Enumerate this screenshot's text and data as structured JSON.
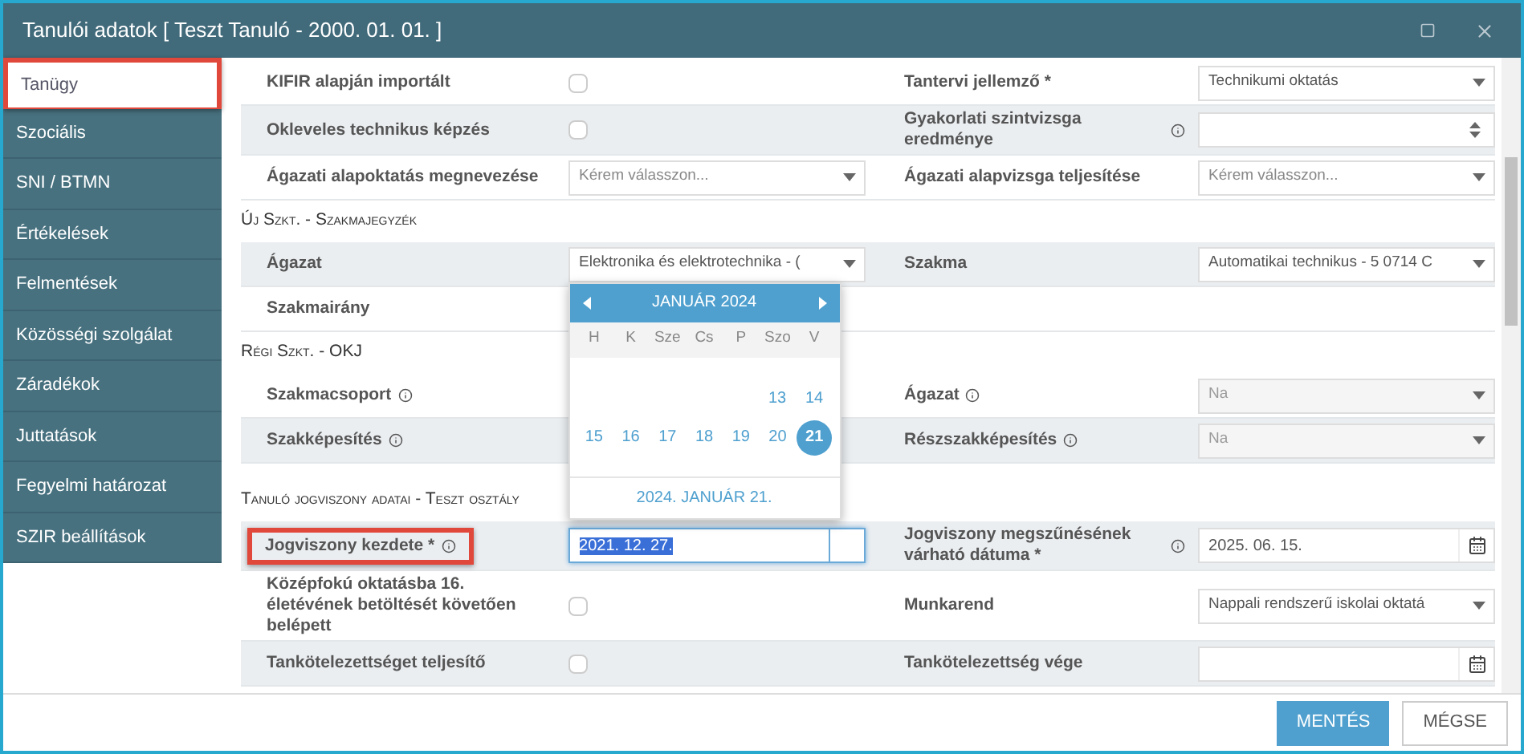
{
  "window": {
    "title": "Tanulói adatok [ Teszt Tanuló - 2000. 01. 01. ]"
  },
  "sidebar": {
    "items": [
      {
        "label": "Tanügy",
        "selected": true,
        "annotated": true
      },
      {
        "label": "Szociális",
        "selected": false,
        "annotated": false
      },
      {
        "label": "SNI / BTMN",
        "selected": false,
        "annotated": false
      },
      {
        "label": "Értékelések",
        "selected": false,
        "annotated": false
      },
      {
        "label": "Felmentések",
        "selected": false,
        "annotated": false
      },
      {
        "label": "Közösségi szolgálat",
        "selected": false,
        "annotated": false
      },
      {
        "label": "Záradékok",
        "selected": false,
        "annotated": false
      },
      {
        "label": "Juttatások",
        "selected": false,
        "annotated": false
      },
      {
        "label": "Fegyelmi határozat",
        "selected": false,
        "annotated": false
      },
      {
        "label": "SZIR beállítások",
        "selected": false,
        "annotated": false
      }
    ]
  },
  "sections": [
    {
      "rows": [
        {
          "striped": false,
          "left": {
            "label": "KIFIR alapján importált",
            "control": {
              "kind": "checkbox",
              "checked": false
            }
          },
          "right": {
            "label": "Tantervi jellemző *",
            "control": {
              "kind": "select",
              "value": "Technikumi oktatás",
              "disabled": false
            }
          }
        },
        {
          "striped": true,
          "left": {
            "label": "Okleveles technikus képzés",
            "control": {
              "kind": "checkbox",
              "checked": false
            }
          },
          "right": {
            "label": "Gyakorlati szintvizsga eredménye",
            "info": true,
            "control": {
              "kind": "number"
            }
          }
        },
        {
          "striped": false,
          "left": {
            "label": "Ágazati alapoktatás megnevezése",
            "control": {
              "kind": "select",
              "placeholder": "Kérem válasszon...",
              "disabled": false
            }
          },
          "right": {
            "label": "Ágazati alapvizsga teljesítése",
            "control": {
              "kind": "select",
              "placeholder": "Kérem válasszon...",
              "disabled": false
            }
          }
        }
      ]
    },
    {
      "title": "Új Szkt. - Szakmajegyzék",
      "rows": [
        {
          "striped": true,
          "left": {
            "label": "Ágazat",
            "control": {
              "kind": "select",
              "value": "Elektronika és elektrotechnika - (",
              "disabled": false,
              "popup": {
                "month": "JANUÁR 2024",
                "weekdays": [
                  "H",
                  "K",
                  "Sze",
                  "Cs",
                  "P",
                  "Szo",
                  "V"
                ],
                "weeks": [
                  {
                    "days": [
                      {
                        "day": "13",
                        "selected": false
                      },
                      {
                        "day": "14",
                        "selected": false
                      }
                    ]
                  },
                  {
                    "days": [
                      {
                        "day": "15",
                        "selected": false
                      },
                      {
                        "day": "16",
                        "selected": false
                      },
                      {
                        "day": "17",
                        "selected": false
                      },
                      {
                        "day": "18",
                        "selected": false
                      },
                      {
                        "day": "19",
                        "selected": false
                      },
                      {
                        "day": "20",
                        "selected": false
                      },
                      {
                        "day": "21",
                        "selected": true
                      }
                    ]
                  }
                ],
                "footer": "2024. JANUÁR 21."
              }
            }
          },
          "right": {
            "label": "Szakma",
            "control": {
              "kind": "select",
              "value": "Automatikai technikus - 5 0714 C",
              "disabled": false
            }
          }
        },
        {
          "striped": false,
          "left": {
            "label": "Szakmairány"
          }
        }
      ]
    },
    {
      "title": "Régi Szkt. - OKJ",
      "rows": [
        {
          "striped": false,
          "left": {
            "label": "Szakmacsoport",
            "info": true
          },
          "right": {
            "label": "Ágazat",
            "info": true,
            "control": {
              "kind": "select",
              "value": "Na",
              "disabled": true
            }
          }
        },
        {
          "striped": true,
          "left": {
            "label": "Szakképesítés",
            "info": true
          },
          "right": {
            "label": "Részszakképesítés",
            "info": true,
            "control": {
              "kind": "select",
              "value": "Na",
              "disabled": true
            }
          }
        }
      ]
    },
    {
      "title": "Tanuló jogviszony adatai - Teszt osztály",
      "rows": [
        {
          "striped": true,
          "left": {
            "label": "Jogviszony kezdete *",
            "info": true,
            "annotated": true,
            "control": {
              "kind": "date",
              "value": "2021. 12. 27.",
              "focused": true
            }
          },
          "right": {
            "label": "Jogviszony megszűnésének várható dátuma *",
            "info": true,
            "control": {
              "kind": "date",
              "value": "2025. 06. 15.",
              "focused": false
            }
          }
        },
        {
          "striped": false,
          "left": {
            "label": "Középfokú oktatásba 16. életévének betöltését követően belépett",
            "control": {
              "kind": "checkbox",
              "checked": false
            }
          },
          "right": {
            "label": "Munkarend",
            "control": {
              "kind": "select",
              "value": "Nappali rendszerű iskolai oktatá",
              "disabled": false
            }
          }
        },
        {
          "striped": true,
          "left": {
            "label": "Tankötelezettséget teljesítő",
            "control": {
              "kind": "checkbox",
              "checked": false
            }
          },
          "right": {
            "label": "Tankötelezettség vége",
            "control": {
              "kind": "date",
              "focused": false
            }
          }
        }
      ]
    }
  ],
  "footer": {
    "buttons": [
      {
        "label": "MENTÉS",
        "kind": "primary"
      },
      {
        "label": "MÉGSE",
        "kind": "secondary"
      }
    ]
  }
}
